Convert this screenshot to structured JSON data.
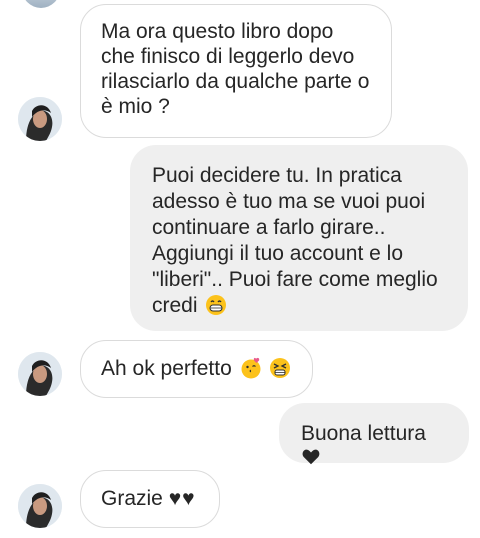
{
  "thread": {
    "messages": [
      {
        "side": "received",
        "text": "Ma ora questo libro dopo che finisco di leggerlo devo rilasciarlo da qualche parte o è mio ?"
      },
      {
        "side": "sent",
        "text": "Puoi decidere tu. In pratica adesso è tuo ma se vuoi puoi continuare a farlo girare.. Aggiungi il tuo account e lo \"liberi\".. Puoi fare come meglio credi"
      },
      {
        "side": "received",
        "text": "Ah ok perfetto"
      },
      {
        "side": "sent",
        "text": "Buona lettura"
      },
      {
        "side": "received",
        "text": "Grazie",
        "suffix": "♥♥"
      }
    ]
  },
  "icons": {
    "avatar": "avatar-photo",
    "grin_emoji": "grinning-face-emoji",
    "kiss_emoji": "face-blowing-kiss-emoji",
    "persevere_emoji": "persevering-face-emoji",
    "heart_emoji": "black-heart-emoji"
  },
  "colors": {
    "sent_bubble": "#efefef",
    "received_border": "#dbdbdb",
    "text": "#262626"
  }
}
